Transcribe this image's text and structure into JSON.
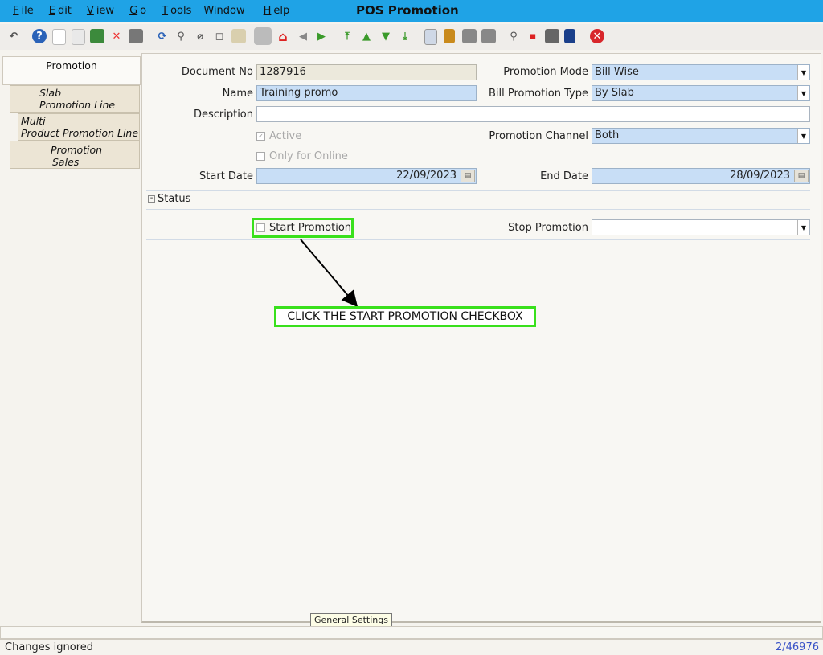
{
  "menu": [
    {
      "label": "File",
      "ul": "F",
      "rest": "ile"
    },
    {
      "label": "Edit",
      "ul": "E",
      "rest": "dit"
    },
    {
      "label": "View",
      "ul": "V",
      "rest": "iew"
    },
    {
      "label": "Go",
      "ul": "G",
      "rest": "o"
    },
    {
      "label": "Tools",
      "ul": "T",
      "rest": "ools"
    },
    {
      "label": "Window",
      "ul": "",
      "rest": "Window"
    },
    {
      "label": "Help",
      "ul": "H",
      "rest": "elp"
    }
  ],
  "window_title": "POS Promotion",
  "tabs": {
    "promotion": "Promotion",
    "slab_1": "Slab",
    "slab_2": "Promotion Line",
    "multi_1": "Multi",
    "multi_2": "Product Promotion Line",
    "sales_1": "Promotion",
    "sales_2": "Sales"
  },
  "form": {
    "document_no_label": "Document No",
    "document_no": "1287916",
    "promotion_mode_label": "Promotion Mode",
    "promotion_mode": "Bill Wise",
    "name_label": "Name",
    "name": "Training promo",
    "bill_promotion_type_label": "Bill Promotion Type",
    "bill_promotion_type": "By Slab",
    "description_label": "Description",
    "description": "",
    "active_label": "Active",
    "promotion_channel_label": "Promotion Channel",
    "promotion_channel": "Both",
    "only_online_label": "Only for Online",
    "start_date_label": "Start Date",
    "start_date": "22/09/2023",
    "end_date_label": "End Date",
    "end_date": "28/09/2023"
  },
  "status_section": {
    "title": "Status",
    "start_promotion_label": "Start Promotion",
    "stop_promotion_label": "Stop Promotion",
    "stop_promotion": ""
  },
  "annotation": "CLICK THE START PROMOTION CHECKBOX",
  "tooltip": "General Settings",
  "statusbar": {
    "message": "Changes ignored",
    "record_counter": "2/46976"
  },
  "colors": {
    "titlebar": "#1fa3e6",
    "highlight": "#39e01c",
    "mandatory_field": "#c8def6"
  }
}
